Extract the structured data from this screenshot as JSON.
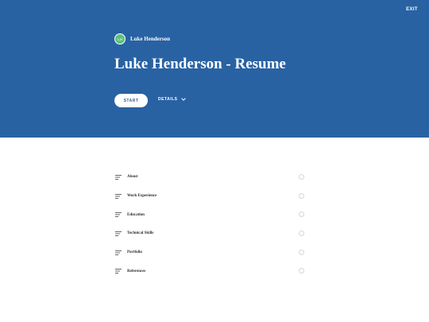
{
  "colors": {
    "accent": "#2862a3",
    "avatar": "#5cbf80"
  },
  "header": {
    "exit_label": "EXIT"
  },
  "author": {
    "initials": "LH",
    "name": "Luke Henderson"
  },
  "course": {
    "title": "Luke Henderson - Resume",
    "start_label": "START",
    "details_label": "DETAILS"
  },
  "outline": {
    "items": [
      {
        "label": "About",
        "icon": "lines-icon"
      },
      {
        "label": "Work Experience",
        "icon": "lines-icon"
      },
      {
        "label": "Education",
        "icon": "lines-icon"
      },
      {
        "label": "Technical Skills",
        "icon": "lines-icon"
      },
      {
        "label": "Portfolio",
        "icon": "lines-icon"
      },
      {
        "label": "References",
        "icon": "lines-icon"
      }
    ]
  }
}
